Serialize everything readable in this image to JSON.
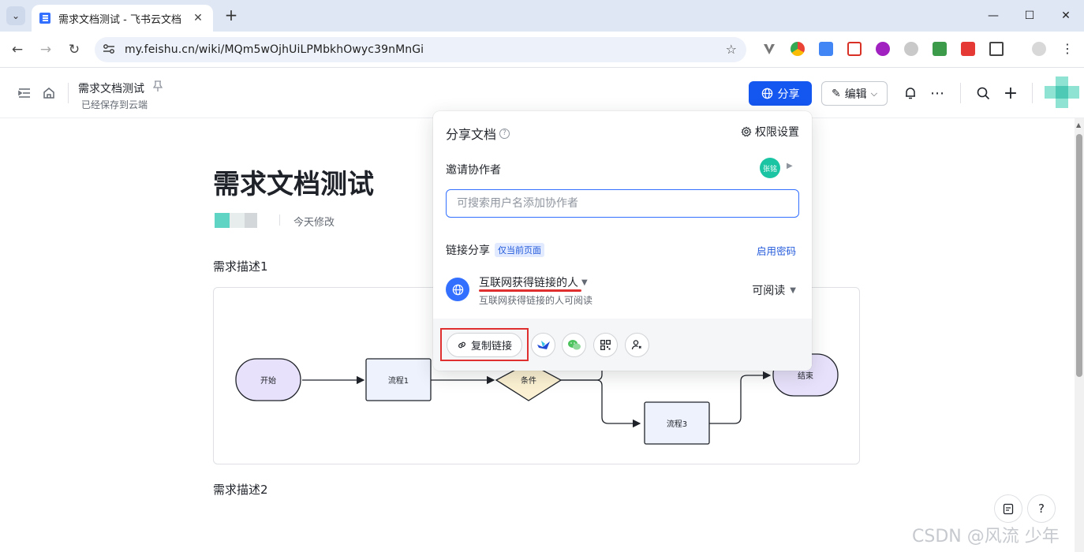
{
  "browser": {
    "tab_title": "需求文档测试 - 飞书云文档",
    "tab_close": "✕",
    "new_tab": "+",
    "url": "my.feishu.cn/wiki/MQm5wOjhUiLPMbkhOwyc39nMnGi",
    "window_controls": {
      "minimize": "—",
      "maximize": "☐",
      "close": "✕"
    }
  },
  "app": {
    "doc_name": "需求文档测试",
    "save_status": "已经保存到云端",
    "share_label": "分享",
    "edit_label": "编辑",
    "accent_color": "#1456f0"
  },
  "doc": {
    "title": "需求文档测试",
    "modified": "今天修改",
    "para1": "需求描述1",
    "para2": "需求描述2"
  },
  "flowchart": {
    "start": "开始",
    "process1": "流程1",
    "condition": "条件",
    "process3": "流程3",
    "end": "结束"
  },
  "share_popover": {
    "title": "分享文档",
    "help_mark": "?",
    "permission_settings": "权限设置",
    "invite_label": "邀请协作者",
    "collaborator_initials": "张铭",
    "search_placeholder": "可搜索用户名添加协作者",
    "link_share_label": "链接分享",
    "scope_badge": "仅当前页面",
    "enable_password": "启用密码",
    "access_scope": "互联网获得链接的人",
    "access_description": "互联网获得链接的人可阅读",
    "permission_level": "可阅读",
    "copy_link": "复制链接",
    "highlight_color": "#e02f2f"
  },
  "watermark": "CSDN @风流 少年"
}
